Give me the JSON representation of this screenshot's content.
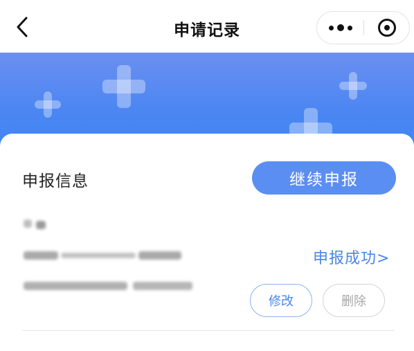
{
  "navbar": {
    "title": "申请记录",
    "back_icon": "chevron-left-icon",
    "more_icon": "more-dots-icon",
    "close_icon": "target-circle-icon"
  },
  "banner": {
    "color": "#4c86f2"
  },
  "record": {
    "section_title": "申报信息",
    "continue_label": "继续申报",
    "status_label": "申报成功>",
    "edit_label": "修改",
    "delete_label": "删除"
  },
  "colors": {
    "accent": "#5b8ef2",
    "link": "#4a86ea",
    "muted": "#a6a6a6"
  }
}
